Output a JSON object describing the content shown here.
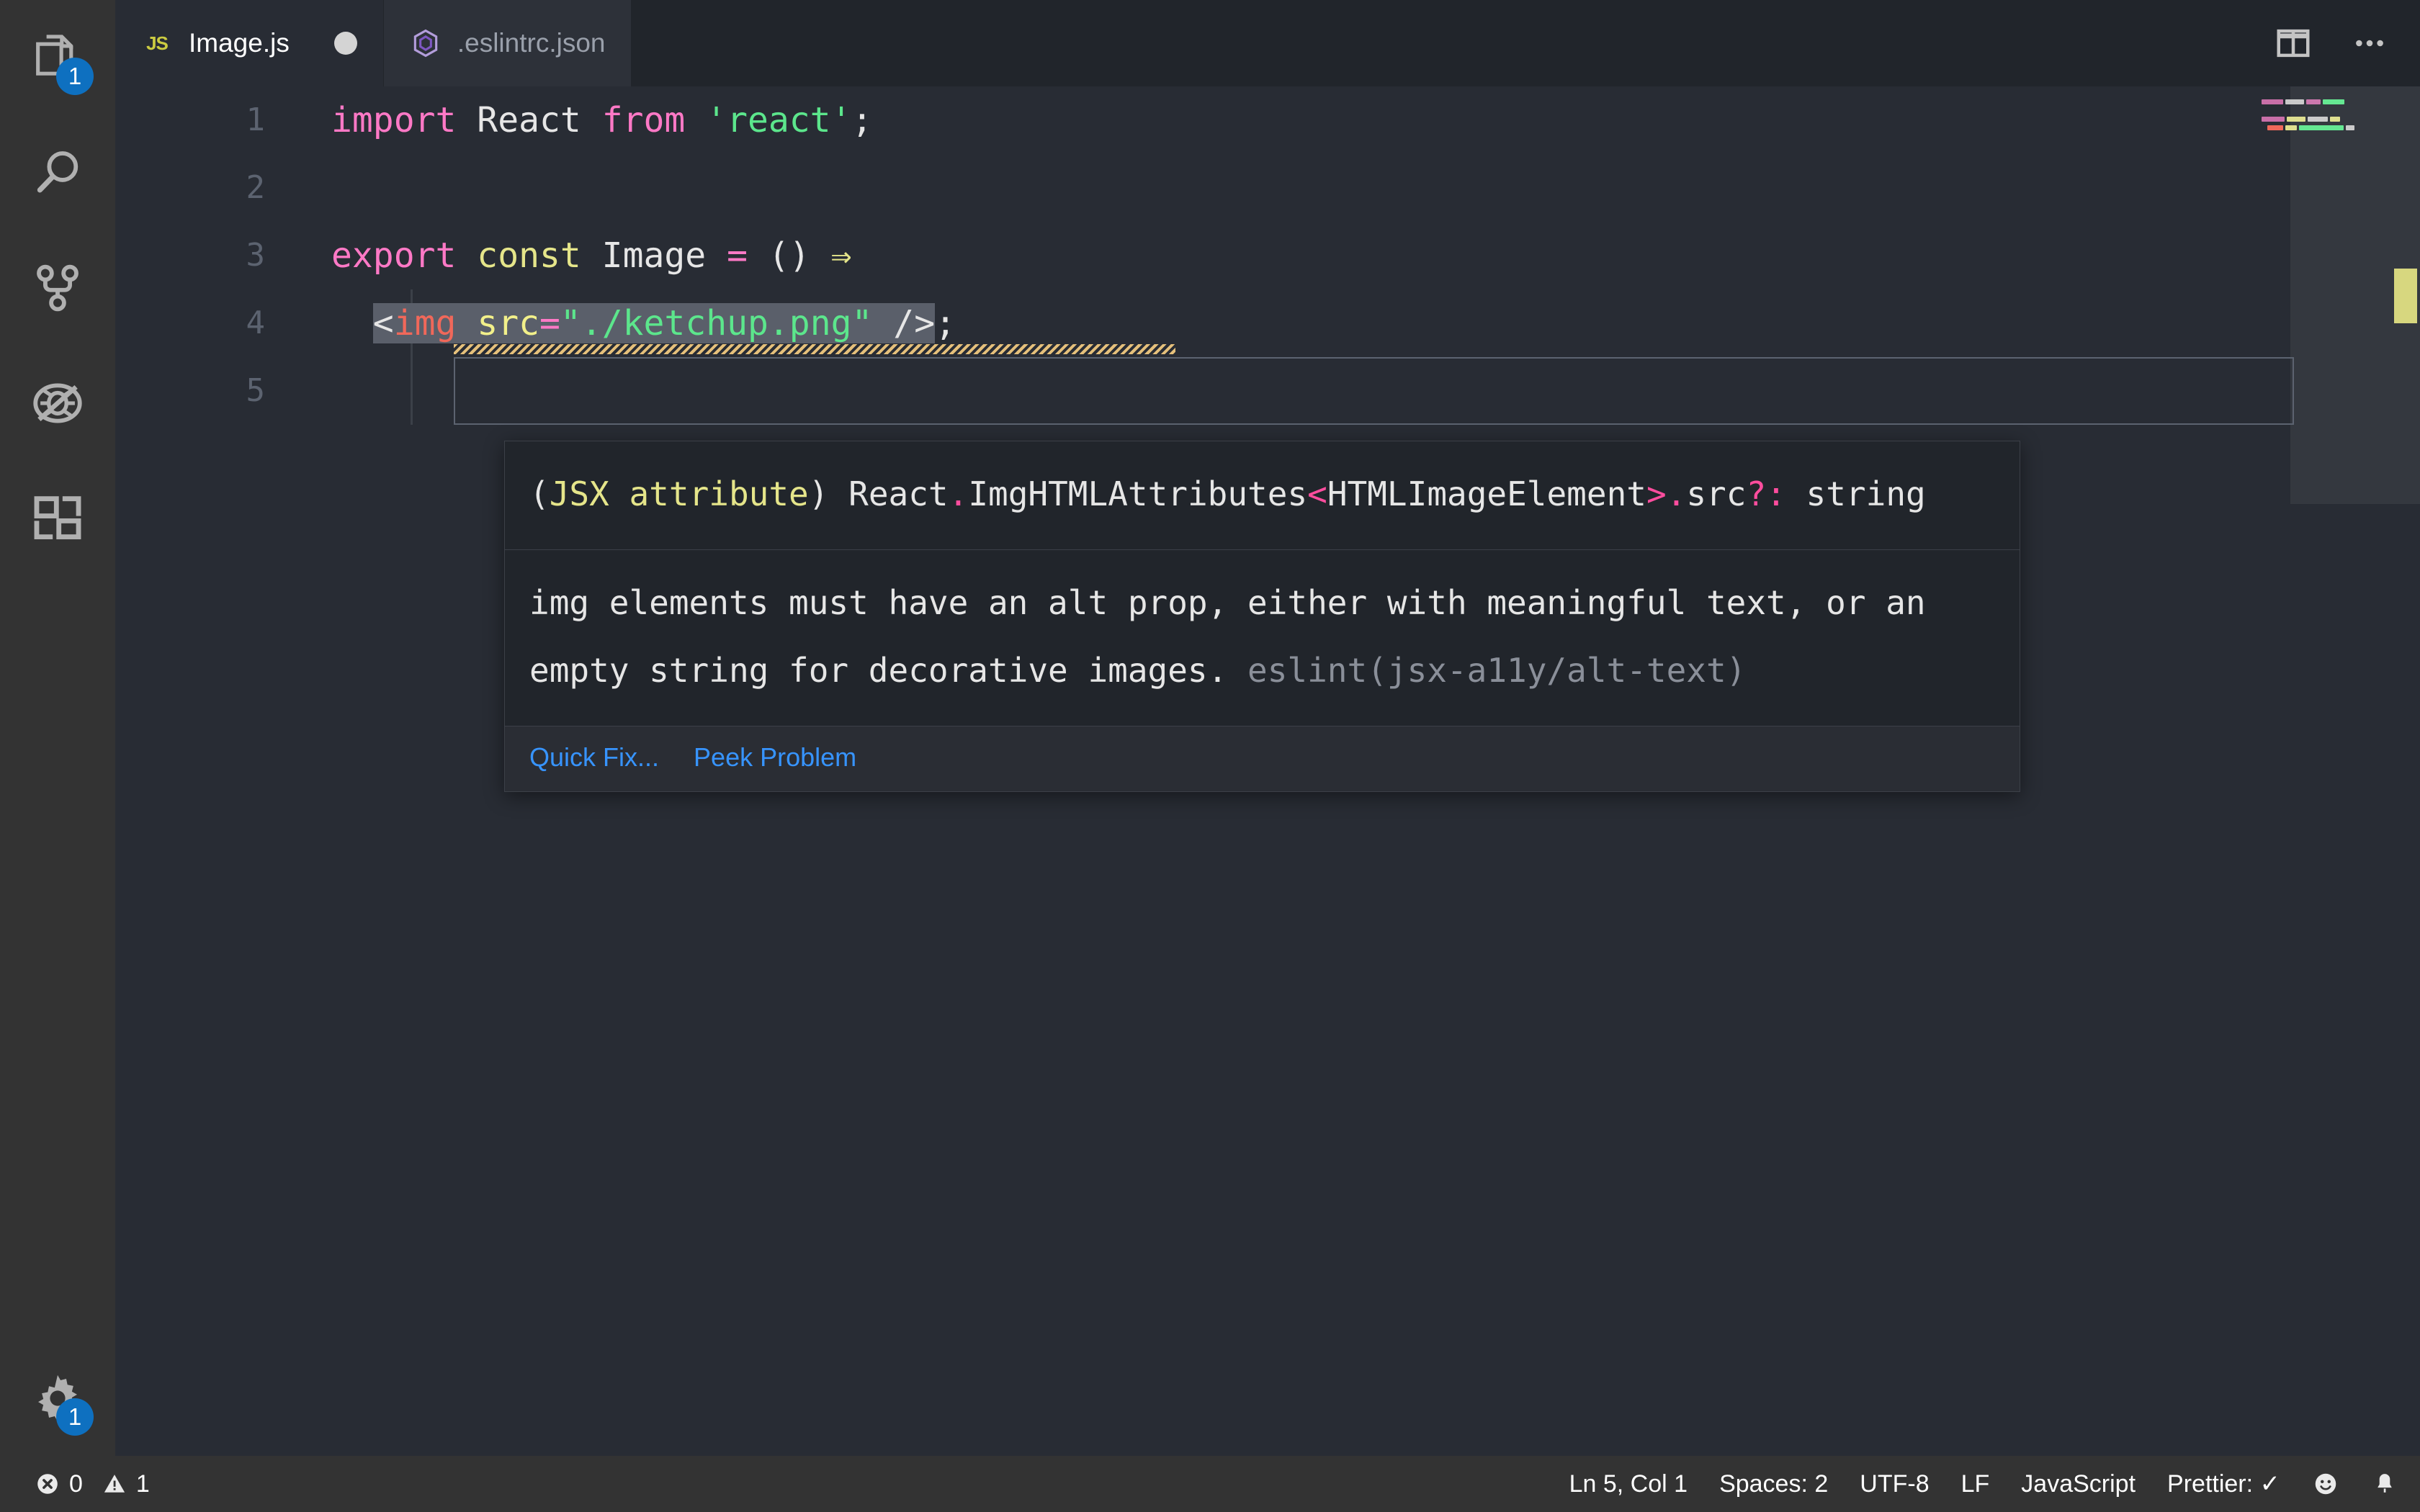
{
  "window": {
    "title": "Image.js"
  },
  "activitybar": {
    "items": [
      {
        "name": "explorer",
        "icon": "files-icon",
        "badge": "1"
      },
      {
        "name": "search",
        "icon": "search-icon",
        "badge": ""
      },
      {
        "name": "source-control",
        "icon": "source-control-icon",
        "badge": ""
      },
      {
        "name": "run-and-debug",
        "icon": "run-debug-icon",
        "badge": ""
      },
      {
        "name": "extensions",
        "icon": "extensions-icon",
        "badge": ""
      }
    ],
    "manage": {
      "name": "manage",
      "icon": "gear-icon",
      "badge": "1"
    }
  },
  "tabs": [
    {
      "label": "Image.js",
      "icon": "js-file-icon",
      "active": true,
      "dirty": true
    },
    {
      "label": ".eslintrc.json",
      "icon": "eslint-file-icon",
      "active": false,
      "dirty": false
    }
  ],
  "tab_actions": [
    {
      "label": "Split Editor",
      "icon": "split-editor-icon"
    },
    {
      "label": "More Actions...",
      "icon": "ellipsis-icon"
    }
  ],
  "editor": {
    "language": "JavaScript",
    "lines": [
      {
        "number": "1",
        "text": "import React from 'react';"
      },
      {
        "number": "2",
        "text": ""
      },
      {
        "number": "3",
        "text": "export const Image = () ⇒"
      },
      {
        "number": "4",
        "text": "  <img src=\"./ketchup.png\" />;"
      },
      {
        "number": "5",
        "text": ""
      }
    ],
    "line1": {
      "import": "import",
      "react": " React ",
      "from": "from",
      "module": " 'react'",
      "semi": ";"
    },
    "line3": {
      "export": "export",
      "const": " const",
      "name": " Image ",
      "equals": "=",
      "parens": " () ",
      "arrow": "⇒"
    },
    "line4": {
      "open": "<",
      "tag": "img",
      "space": " ",
      "attr": "src",
      "eq": "=",
      "value": "\"./ketchup.png\"",
      "close": " />",
      "semi": ";"
    },
    "selected_text": "<img src=\"./ketchup.png\" />"
  },
  "hover": {
    "signature": {
      "lead": "(",
      "jsx": "JSX",
      "attribute": " attribute",
      "close": ") React",
      "dot1": ".",
      "type": "ImgHTMLAttributes",
      "lt": "<",
      "generic": "HTMLImageElement",
      "gt": ">",
      "dot2": ".",
      "prop": "src",
      "optional": "?:",
      "valuetype": " string"
    },
    "message": "img elements must have an alt prop, either with meaningful text, or an empty string for decorative images.",
    "rule": "eslint(jsx-a11y/alt-text)",
    "actions": [
      {
        "label": "Quick Fix...",
        "name": "quick-fix"
      },
      {
        "label": "Peek Problem",
        "name": "peek-problem"
      }
    ]
  },
  "statusbar": {
    "problems": {
      "error_icon": "error-icon",
      "error_count": "0",
      "warning_icon": "warning-icon",
      "warning_count": "1"
    },
    "right_items": [
      {
        "label": "Ln 5, Col 1",
        "name": "cursor-position"
      },
      {
        "label": "Spaces: 2",
        "name": "indentation"
      },
      {
        "label": "UTF-8",
        "name": "encoding"
      },
      {
        "label": "LF",
        "name": "eol"
      },
      {
        "label": "JavaScript",
        "name": "language-mode"
      },
      {
        "label": "Prettier: ✓",
        "name": "prettier-status"
      }
    ],
    "feedback_icon": "smiley-icon",
    "notifications_icon": "bell-icon"
  },
  "colors": {
    "editor_bg": "#282c34",
    "tabbar_bg": "#21252b",
    "activitybar_bg": "#333333",
    "statusbar_bg": "#333333",
    "badge_blue": "#0e70c0",
    "link_blue": "#3794ff",
    "keyword_pink": "#ff79c6",
    "string_green": "#5ce68c",
    "tag_red": "#f0685a",
    "attr_yellow": "#f2f08a",
    "warning_yellow": "#e5c07b",
    "selection_grey": "#5a5f6a"
  }
}
